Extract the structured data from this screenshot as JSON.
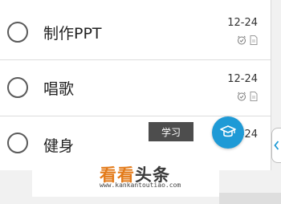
{
  "tasks": [
    {
      "title": "制作PPT",
      "date": "12-24",
      "icons": [
        "alarm-clock-icon",
        "note-icon"
      ]
    },
    {
      "title": "唱歌",
      "date": "12-24",
      "icons": [
        "alarm-clock-icon",
        "note-icon"
      ]
    },
    {
      "title": "健身",
      "date": "12-24"
    }
  ],
  "tooltip": {
    "text": "学习"
  },
  "fab": {
    "icon": "graduation-cap-icon",
    "color": "#1e9ad6"
  },
  "side_tab": {
    "icon": "chevron-left-icon"
  },
  "watermark": {
    "brand_a": "看看",
    "brand_b": "头条",
    "url": "www.kankantoutiao.com",
    "accent": "#e37b1b"
  }
}
